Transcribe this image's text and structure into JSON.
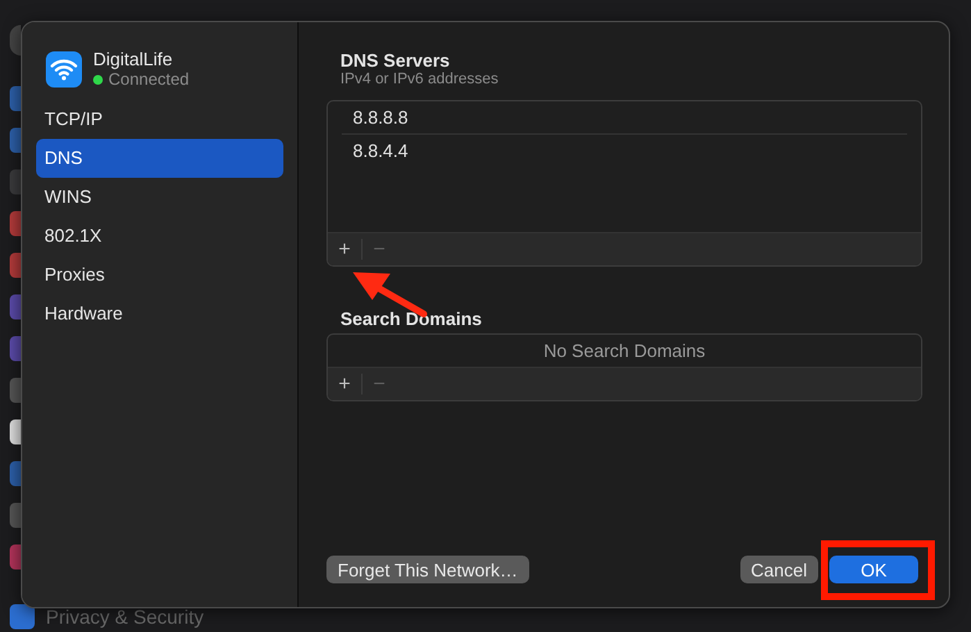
{
  "background": {
    "footer_item": "Privacy & Security"
  },
  "network": {
    "name": "DigitalLife",
    "status": "Connected",
    "connected": true
  },
  "sidebar": {
    "items": [
      {
        "label": "TCP/IP",
        "selected": false
      },
      {
        "label": "DNS",
        "selected": true
      },
      {
        "label": "WINS",
        "selected": false
      },
      {
        "label": "802.1X",
        "selected": false
      },
      {
        "label": "Proxies",
        "selected": false
      },
      {
        "label": "Hardware",
        "selected": false
      }
    ]
  },
  "dns_servers": {
    "title": "DNS Servers",
    "subtitle": "IPv4 or IPv6 addresses",
    "entries": [
      "8.8.8.8",
      "8.8.4.4"
    ],
    "add": "+",
    "remove": "−"
  },
  "search_domains": {
    "title": "Search Domains",
    "empty": "No Search Domains",
    "add": "+",
    "remove": "−"
  },
  "buttons": [
    {
      "label": "Forget This Network…",
      "kind": "secondary"
    },
    {
      "label": "Cancel",
      "kind": "secondary"
    },
    {
      "label": "OK",
      "kind": "primary"
    }
  ]
}
